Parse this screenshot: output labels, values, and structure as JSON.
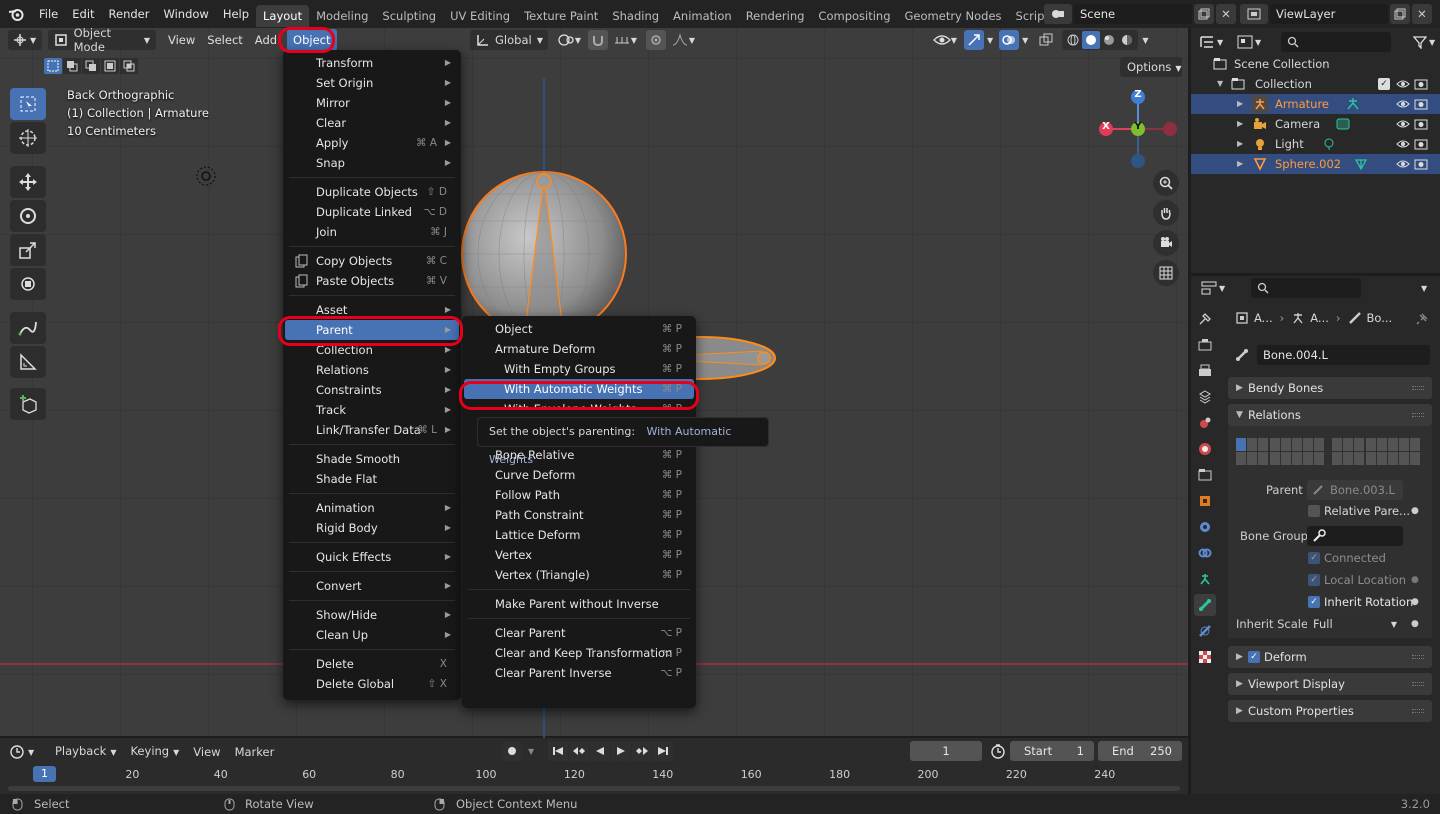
{
  "menubar": {
    "items": [
      "File",
      "Edit",
      "Render",
      "Window",
      "Help"
    ],
    "workspaces": [
      "Layout",
      "Modeling",
      "Sculpting",
      "UV Editing",
      "Texture Paint",
      "Shading",
      "Animation",
      "Rendering",
      "Compositing",
      "Geometry Nodes",
      "Scripting"
    ],
    "active_workspace": "Layout",
    "scene": "Scene",
    "view_layer": "ViewLayer"
  },
  "viewport_header": {
    "mode": "Object Mode",
    "menus": [
      "View",
      "Select",
      "Add",
      "Object"
    ],
    "transform_orientation": "Global",
    "options_label": "Options"
  },
  "viewport_info": {
    "view": "Back Orthographic",
    "collection": "(1) Collection | Armature",
    "scale": "10 Centimeters"
  },
  "gizmo": {
    "z": "Z",
    "y": "Y",
    "x": "X"
  },
  "object_menu": {
    "groups": [
      [
        {
          "label": "Transform",
          "submenu": true
        },
        {
          "label": "Set Origin",
          "submenu": true
        },
        {
          "label": "Mirror",
          "submenu": true
        },
        {
          "label": "Clear",
          "submenu": true
        },
        {
          "label": "Apply",
          "shortcut": "⌘ A",
          "submenu": true
        },
        {
          "label": "Snap",
          "submenu": true
        }
      ],
      [
        {
          "label": "Duplicate Objects",
          "shortcut": "⇧ D"
        },
        {
          "label": "Duplicate Linked",
          "shortcut": "⌥ D"
        },
        {
          "label": "Join",
          "shortcut": "⌘ J"
        }
      ],
      [
        {
          "label": "Copy Objects",
          "shortcut": "⌘ C",
          "icon": "copy-icon"
        },
        {
          "label": "Paste Objects",
          "shortcut": "⌘ V",
          "icon": "paste-icon"
        }
      ],
      [
        {
          "label": "Asset",
          "submenu": true
        },
        {
          "label": "Parent",
          "submenu": true,
          "highlighted": true
        },
        {
          "label": "Collection",
          "submenu": true
        },
        {
          "label": "Relations",
          "submenu": true
        },
        {
          "label": "Constraints",
          "submenu": true
        },
        {
          "label": "Track",
          "submenu": true
        },
        {
          "label": "Link/Transfer Data",
          "shortcut": "⌘ L",
          "submenu": true
        }
      ],
      [
        {
          "label": "Shade Smooth"
        },
        {
          "label": "Shade Flat"
        }
      ],
      [
        {
          "label": "Animation",
          "submenu": true
        },
        {
          "label": "Rigid Body",
          "submenu": true
        }
      ],
      [
        {
          "label": "Quick Effects",
          "submenu": true
        }
      ],
      [
        {
          "label": "Convert",
          "submenu": true
        }
      ],
      [
        {
          "label": "Show/Hide",
          "submenu": true
        },
        {
          "label": "Clean Up",
          "submenu": true
        }
      ],
      [
        {
          "label": "Delete",
          "shortcut": "X"
        },
        {
          "label": "Delete Global",
          "shortcut": "⇧ X"
        }
      ]
    ]
  },
  "parent_menu": {
    "top": [
      {
        "label": "Object",
        "shortcut": "⌘ P"
      },
      {
        "label": "Armature Deform",
        "shortcut": "⌘ P"
      },
      {
        "label": "With Empty Groups",
        "shortcut": "⌘ P",
        "indent": true
      },
      {
        "label": "With Automatic Weights",
        "shortcut": "⌘ P",
        "indent": true,
        "highlighted": true
      },
      {
        "label": "With Envelope Weights",
        "shortcut": "⌘ P",
        "indent": true
      }
    ],
    "rest": [
      [
        {
          "label": "Bone Relative",
          "shortcut": "⌘ P"
        },
        {
          "label": "Curve Deform",
          "shortcut": "⌘ P"
        },
        {
          "label": "Follow Path",
          "shortcut": "⌘ P"
        },
        {
          "label": "Path Constraint",
          "shortcut": "⌘ P"
        },
        {
          "label": "Lattice Deform",
          "shortcut": "⌘ P"
        },
        {
          "label": "Vertex",
          "shortcut": "⌘ P"
        },
        {
          "label": "Vertex (Triangle)",
          "shortcut": "⌘ P"
        }
      ],
      [
        {
          "label": "Make Parent without Inverse"
        }
      ],
      [
        {
          "label": "Clear Parent",
          "shortcut": "⌥ P"
        },
        {
          "label": "Clear and Keep Transformation",
          "shortcut": "⌥ P"
        },
        {
          "label": "Clear Parent Inverse",
          "shortcut": "⌥ P"
        }
      ]
    ]
  },
  "tooltip": {
    "text": "Set the object's parenting:",
    "value": "With Automatic Weights"
  },
  "outliner": {
    "scene_collection": "Scene Collection",
    "collection": "Collection",
    "items": [
      {
        "label": "Armature",
        "selected": true,
        "color": "#ff9a3c"
      },
      {
        "label": "Camera",
        "selected": false,
        "color": "#d8d8d8"
      },
      {
        "label": "Light",
        "selected": false,
        "color": "#d8d8d8"
      },
      {
        "label": "Sphere.002",
        "selected": true,
        "color": "#ff9a3c"
      }
    ]
  },
  "properties": {
    "breadcrumb": [
      "A...",
      "A...",
      "Bo..."
    ],
    "bone_name": "Bone.004.L",
    "panels": {
      "bendy_bones": "Bendy Bones",
      "relations": "Relations",
      "deform": "Deform",
      "viewport_display": "Viewport Display",
      "custom_properties": "Custom Properties"
    },
    "parent_label": "Parent",
    "parent_value": "Bone.003.L",
    "relative_parent": "Relative Pare...",
    "bone_group_label": "Bone Group",
    "connected": "Connected",
    "local_location": "Local Location",
    "inherit_rotation": "Inherit Rotation",
    "inherit_scale_label": "Inherit Scale",
    "inherit_scale_value": "Full"
  },
  "timeline": {
    "menus": [
      "Playback",
      "Keying",
      "View",
      "Marker"
    ],
    "current_frame": "1",
    "start_label": "Start",
    "start": "1",
    "end_label": "End",
    "end": "250",
    "ticks": [
      "20",
      "40",
      "60",
      "80",
      "100",
      "120",
      "140",
      "160",
      "180",
      "200",
      "220",
      "240"
    ],
    "frame_indicator": "1"
  },
  "statusbar": {
    "select": "Select",
    "rotate": "Rotate View",
    "context": "Object Context Menu",
    "version": "3.2.0"
  },
  "colors": {
    "accent": "#4772b3",
    "highlight_outline": "#e8001b",
    "selection_orange": "#ff8c1a"
  }
}
